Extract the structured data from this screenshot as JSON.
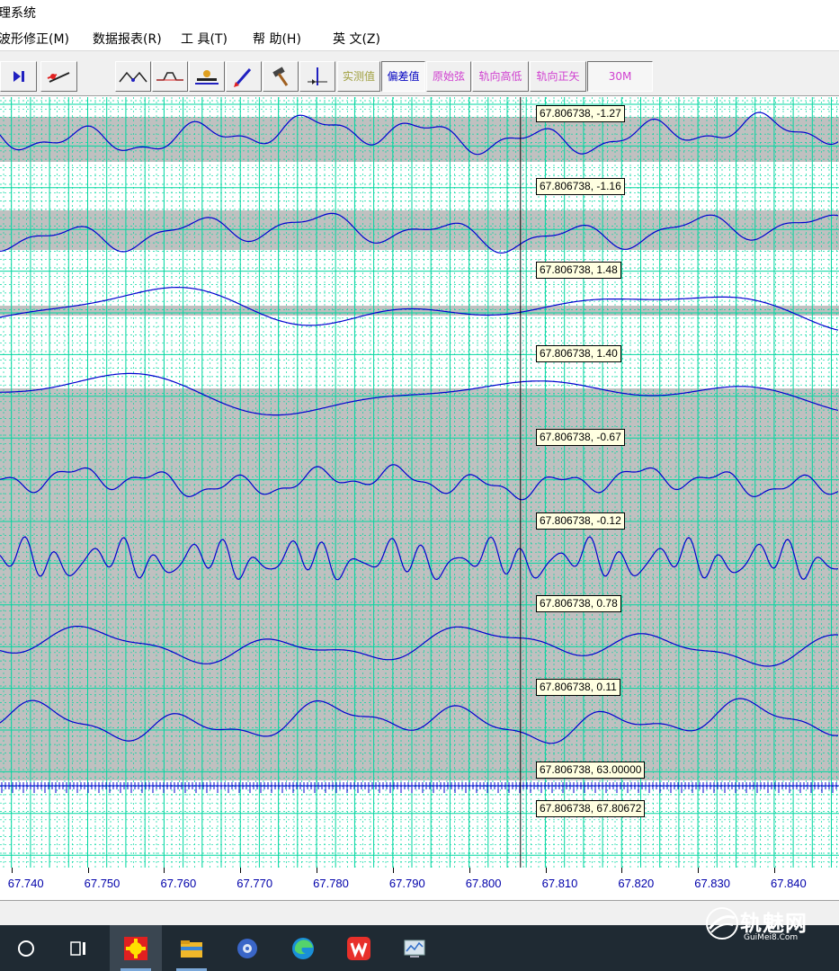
{
  "window": {
    "title": "理系统"
  },
  "menu": [
    {
      "label": "波形修正(M)"
    },
    {
      "label": "数据报表(R)"
    },
    {
      "label": "工 具(T)"
    },
    {
      "label": "帮 助(H)"
    },
    {
      "label": "英 文(Z)"
    }
  ],
  "toolbar": {
    "measured_label": "实测值",
    "deviation_label": "偏差值",
    "original_chord_label": "原始弦",
    "rail_height_label": "轨向高低",
    "rail_versine_label": "轨向正矢",
    "chord_length_label": "30M",
    "icons": [
      "step-forward-icon",
      "pen-line-icon",
      "peak-wave-icon",
      "flat-wave-icon",
      "gauge-icon",
      "paint-brush-icon",
      "hammer-icon",
      "cursor-split-icon"
    ],
    "active_mode": "deviation"
  },
  "colors": {
    "grid": "#00d7a0",
    "band": "#c0c0c0",
    "trace": "#0000d0",
    "cursor": "#000000",
    "readout_bg": "#ffffe1",
    "axis_text": "#0000aa"
  },
  "cursor": {
    "x": 67.806738
  },
  "readouts": [
    {
      "label": "67.806738, -1.27"
    },
    {
      "label": "67.806738, -1.16"
    },
    {
      "label": "67.806738, 1.48"
    },
    {
      "label": "67.806738, 1.40"
    },
    {
      "label": "67.806738, -0.67"
    },
    {
      "label": "67.806738, -0.12"
    },
    {
      "label": "67.806738, 0.78"
    },
    {
      "label": "67.806738, 0.11"
    },
    {
      "label": "67.806738, 63.00000"
    },
    {
      "label": "67.806738, 67.80672"
    }
  ],
  "chart_data": {
    "type": "line",
    "xlim": [
      67.7385,
      67.8485
    ],
    "x_ticks": [
      "67.740",
      "67.750",
      "67.760",
      "67.770",
      "67.780",
      "67.790",
      "67.800",
      "67.810",
      "67.820",
      "67.830",
      "67.840"
    ],
    "x_tick_values": [
      67.74,
      67.75,
      67.76,
      67.77,
      67.78,
      67.79,
      67.8,
      67.81,
      67.82,
      67.83,
      67.84
    ],
    "grid": true,
    "cursor_x": 67.806738,
    "series": [
      {
        "cursor_value": -1.27
      },
      {
        "cursor_value": -1.16
      },
      {
        "cursor_value": 1.48
      },
      {
        "cursor_value": 1.4
      },
      {
        "cursor_value": -0.67
      },
      {
        "cursor_value": -0.12
      },
      {
        "cursor_value": 0.78
      },
      {
        "cursor_value": 0.11
      },
      {
        "cursor_value": 63.0
      },
      {
        "cursor_value": 67.80672
      }
    ]
  },
  "taskbar": {
    "items": [
      "start-icon",
      "task-view-icon",
      "track-app-icon",
      "file-explorer-icon",
      "settings-app-icon",
      "edge-browser-icon",
      "wps-office-icon",
      "system-monitor-icon"
    ]
  },
  "watermark": {
    "text": "轨魅网",
    "subtext": "GuiMei8.Com"
  }
}
